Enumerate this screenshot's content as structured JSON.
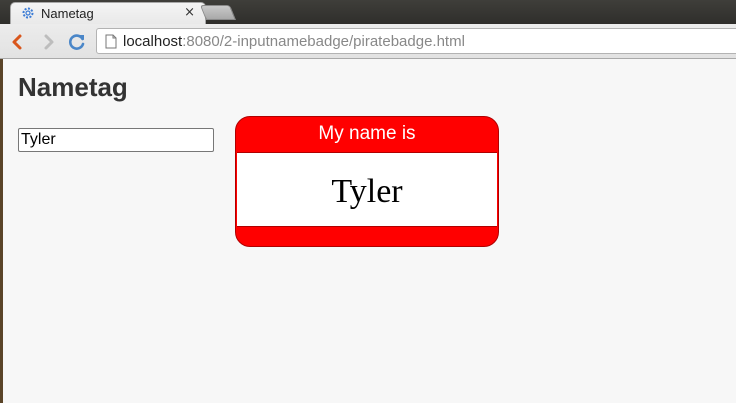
{
  "browser": {
    "tab": {
      "title": "Nametag",
      "icon": "gear-icon"
    },
    "url": {
      "host": "localhost",
      "path": ":8080/2-inputnamebadge/piratebadge.html"
    },
    "nav": {
      "back_icon": "back-arrow-icon",
      "forward_icon": "forward-arrow-icon",
      "reload_icon": "reload-icon"
    }
  },
  "page": {
    "title": "Nametag",
    "input": {
      "value": "Tyler"
    },
    "badge": {
      "header": "My name is",
      "name": "Tyler",
      "color": "#ff0000"
    }
  }
}
